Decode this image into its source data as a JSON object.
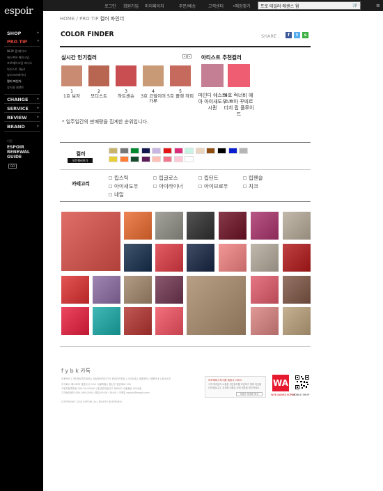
{
  "sidebar": {
    "logo": "espoir",
    "nav": [
      {
        "label": "SHOP",
        "active": false
      },
      {
        "label": "PRO TIP",
        "active": true
      },
      {
        "label": "CHANGE",
        "active": false
      },
      {
        "label": "SERVICE",
        "active": false
      },
      {
        "label": "REVIEW",
        "active": false
      },
      {
        "label": "BRAND",
        "active": false
      }
    ],
    "protip_sub": [
      "NEW 잼 메이크",
      "에스쁘아 메이크업",
      "프로메이크업 비디오",
      "아티스트 Q&A",
      "뷰티크리에이터",
      "컬러 파인더",
      "뷰티살 셀렌트"
    ],
    "renewal_label": "이전",
    "renewal_title": "ESPOIR RENEWAL GUIDE",
    "renewal_btn": "GO"
  },
  "topbar": {
    "links": [
      "로그인",
      "회원가입",
      "마이페이지",
      "주문/배송",
      "고객센터",
      "매장찾기"
    ],
    "search_value": "프로 테일러 에센스 웜",
    "cart": "0",
    "menu_icon": "hamburger-icon"
  },
  "breadcrumb": {
    "home": "HOME",
    "sep": "/",
    "level1": "PRO TIP",
    "current": "컬러 파인더"
  },
  "page_title": "COLOR FINDER",
  "share_label": "SHARE :",
  "popular": {
    "title": "실시간 인기컬러",
    "items": [
      {
        "rank": "1",
        "name": "1호 보자",
        "color": "#c98c72"
      },
      {
        "rank": "2",
        "name": "모디스트",
        "color": "#b86652"
      },
      {
        "rank": "3",
        "name": "하트센슈",
        "color": "#c94e52"
      },
      {
        "rank": "4",
        "name": "3호 코랄이어 가루",
        "color": "#c99a76"
      },
      {
        "rank": "5",
        "name": "5호 플렛 하피",
        "color": "#c56a5c"
      }
    ],
    "note": "* 일주일간의 판매량을 집계한 순위입니다."
  },
  "artist": {
    "title": "아티스트 추천컬러",
    "items": [
      {
        "name": "마인디 에스쁘아 아이새도우 시퀸",
        "color": "#c47f95"
      },
      {
        "name": "4호 럭너비 에스쁘아 꾸띄르 더치 립 플루이드",
        "color": "#ee5d72"
      }
    ]
  },
  "filter": {
    "color_label": "컬러",
    "color_button": "모든컬러보기",
    "colors": [
      "#c9b36a",
      "#777777",
      "#00882e",
      "#12174f",
      "#c8b6e2",
      "#e31414",
      "#db2d7a",
      "#c8f4e6",
      "#ead5bf",
      "#8f4e10",
      "#000000",
      "#0a1ed0",
      "#b5b5b5",
      "#e8cf33",
      "#ff7c35",
      "#174b2e",
      "#5b1c57",
      "#ffbfb5",
      "#f2758a",
      "#ffc8d7",
      "#ffffff"
    ],
    "category_label": "카테고리",
    "categories": [
      "립스틱",
      "립글로스",
      "립틴트",
      "립펜슬",
      "아이새도우",
      "아이라이너",
      "아이브로우",
      "치크",
      "네일"
    ]
  },
  "results": [
    {
      "color": "#d84f47"
    },
    {
      "color": "#ea6a2e"
    },
    {
      "color": "#8f8f86"
    },
    {
      "color": "#2e2e2e"
    },
    {
      "color": "#6d1023"
    },
    {
      "color": "#a9336c"
    },
    {
      "color": "#b6aa99"
    },
    {
      "color": "#152f4c"
    },
    {
      "color": "#dd3943"
    },
    {
      "color": "#162543"
    },
    {
      "color": "#f08080"
    },
    {
      "color": "#b3a99a"
    },
    {
      "color": "#b21818"
    },
    {
      "color": "#dd2f2f"
    },
    {
      "color": "#8b6ba2"
    },
    {
      "color": "#a1866b"
    },
    {
      "color": "#6f3450"
    },
    {
      "color": "#a88a6a"
    },
    {
      "color": "#e05a6a"
    },
    {
      "color": "#7e5645"
    },
    {
      "color": "#e91d3e"
    },
    {
      "color": "#18a9a6"
    },
    {
      "color": "#b3332f"
    },
    {
      "color": "#f0505f"
    },
    {
      "color": "#d8827f"
    },
    {
      "color": "#b9a07a"
    }
  ],
  "footer": {
    "social_icons": "f  y  b  k  카톡",
    "lines": [
      "이용약관 | 개인정보처리방침 | 영상정보처리기기 운영관리방침 | 사이트맵 | 제휴문의 | 채용안내 | 회사소개",
      "주식회사 에스쁘아 대표이사 OOO 서울특별시 용산구 한강대로 100",
      "사업자등록번호 000-00-00000 | 통신판매업신고 제0000-서울용산-0000호",
      "고객상담센터 080-000-0000 | 평일 09:00~18:00 | 이메일 espoir@espoir.com",
      "COPYRIGHT 2014 ESPOIR. ALL RIGHTS RESERVED."
    ],
    "box_title": "아모레퍼시픽그룹 제휴사 서비스",
    "box_body": "고객 여러분의 소중한 개인정보를 보호하기 위해 최선을 다하겠습니다. 자세한 내용은 아래 버튼을 확인하세요.",
    "box_button": "서비스 자세히 보기",
    "award": "WA",
    "award_caption": "WEB AWARD KOREA",
    "qr_caption": "MOBILE SHOP"
  }
}
